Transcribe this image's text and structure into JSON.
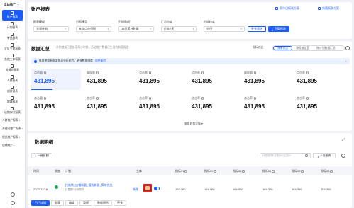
{
  "sidebar": {
    "top_label": "全站推广",
    "items": [
      {
        "label": "账户报表",
        "active": true
      },
      {
        "label": "计划报表"
      },
      {
        "label": "单元报表"
      },
      {
        "label": "宝贝主体报表"
      },
      {
        "label": "其他主体报表"
      },
      {
        "label": "关键词报表"
      },
      {
        "label": "人群报表"
      },
      {
        "label": "创意报表"
      },
      {
        "label": "地域报表"
      },
      {
        "label": "店铺实时报表"
      }
    ],
    "sub_groups": [
      "人群推广报表",
      "关键词推广报表",
      "货品推广报表",
      "店铺推广"
    ]
  },
  "report_card": {
    "title": "账户报表",
    "links": [
      "帮年日报表方案",
      "新版报表方案"
    ],
    "filters": [
      {
        "label": "报表模板",
        "value": "全量计划"
      },
      {
        "label": "归因模型",
        "value": "末次点击归因"
      },
      {
        "label": "归因周期",
        "value": "15天累计数据"
      },
      {
        "label": "汇总粒度",
        "value": "过去7天"
      },
      {
        "label": "时间粒度",
        "value": "分日"
      }
    ],
    "more_button": "更多筛选",
    "download_button": "下载报表"
  },
  "summary_card": {
    "title": "数据汇总",
    "subtitle": "计划数据已更新至两小时前，历史推广数据已生成为新版报告",
    "tabs": [
      "效果对比",
      "按投放设置",
      "按计划数据汇总"
    ],
    "active_tab": 0,
    "banner_text": "推荐使用新版本报表分析能力，更多数据维度",
    "banner_link": "前往体验",
    "metrics": [
      {
        "label": "点击量",
        "value": "431,895",
        "selected": true
      },
      {
        "label": "展现量",
        "value": "431,895"
      },
      {
        "label": "点击率",
        "value": "431,895"
      },
      {
        "label": "点击率",
        "value": "431,895"
      },
      {
        "label": "展现量",
        "value": "431,895"
      },
      {
        "label": "点击率",
        "value": "431,895"
      },
      {
        "label": "点击量",
        "value": "431,895"
      },
      {
        "label": "点击率",
        "value": "431,895"
      },
      {
        "label": "点击率",
        "value": "431,895"
      },
      {
        "label": "点击率",
        "value": "431,895"
      },
      {
        "label": "点击率",
        "value": "431,895"
      },
      {
        "label": "点击率",
        "value": "431,895"
      }
    ],
    "view_more": "查看趋势详情"
  },
  "detail_card": {
    "title": "数据明细",
    "add_button": "一键复制",
    "search_placeholder": "计划名称/计划ID/宝贝ID",
    "download_button": "下载报表",
    "columns": [
      "时间",
      "状态",
      "计划",
      "主体",
      "指标01",
      "指标02",
      "指标03",
      "指标01",
      "指标02",
      "指标03"
    ],
    "rows": [
      {
        "date": "2022/12/16",
        "plan_title": "拉新快_店铺新客_搜狗新客_简单优先",
        "plan_sub": "日限额/计划预算",
        "edit": "修改",
        "values": [
          "164,360",
          "164,360",
          "164,360",
          "164,360",
          "164,360",
          "164,360"
        ]
      }
    ],
    "actions": [
      "日日详情",
      "报表",
      "编辑",
      "暂停",
      "数据图示",
      "更多"
    ]
  }
}
